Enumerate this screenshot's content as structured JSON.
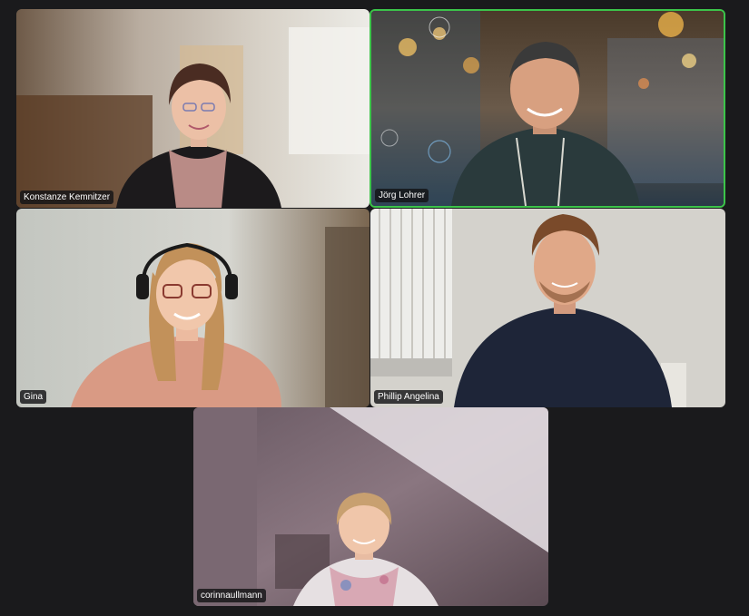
{
  "participants": [
    {
      "name": "Konstanze Kemnitzer",
      "active_speaker": false
    },
    {
      "name": "Jörg Lohrer",
      "active_speaker": true
    },
    {
      "name": "Gina",
      "active_speaker": false
    },
    {
      "name": "Phillip Angelina",
      "active_speaker": false
    },
    {
      "name": "corinnaullmann",
      "active_speaker": false
    }
  ],
  "colors": {
    "background": "#1a1a1c",
    "active_speaker_border": "#3cc44a",
    "name_tag_bg": "#141416"
  }
}
